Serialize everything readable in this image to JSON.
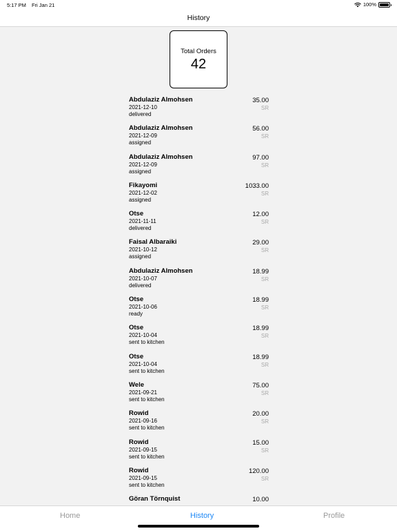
{
  "status_bar": {
    "time": "5:17 PM",
    "date": "Fri Jan 21",
    "battery": "100%",
    "battery_level": 1.0
  },
  "nav": {
    "title": "History"
  },
  "summary": {
    "label": "Total Orders",
    "value": "42"
  },
  "orders": [
    {
      "name": "Abdulaziz Almohsen",
      "date": "2021-12-10",
      "status": "delivered",
      "amount": "35.00",
      "currency": "SR"
    },
    {
      "name": "Abdulaziz Almohsen",
      "date": "2021-12-09",
      "status": "assigned",
      "amount": "56.00",
      "currency": "SR"
    },
    {
      "name": "Abdulaziz Almohsen",
      "date": "2021-12-09",
      "status": "assigned",
      "amount": "97.00",
      "currency": "SR"
    },
    {
      "name": "Fikayomi",
      "date": "2021-12-02",
      "status": "assigned",
      "amount": "1033.00",
      "currency": "SR"
    },
    {
      "name": "Otse",
      "date": "2021-11-11",
      "status": "delivered",
      "amount": "12.00",
      "currency": "SR"
    },
    {
      "name": "Faisal Albaraiki",
      "date": "2021-10-12",
      "status": "assigned",
      "amount": "29.00",
      "currency": "SR"
    },
    {
      "name": "Abdulaziz Almohsen",
      "date": "2021-10-07",
      "status": "delivered",
      "amount": "18.99",
      "currency": "SR"
    },
    {
      "name": "Otse",
      "date": "2021-10-06",
      "status": "ready",
      "amount": "18.99",
      "currency": "SR"
    },
    {
      "name": "Otse",
      "date": "2021-10-04",
      "status": "sent to kitchen",
      "amount": "18.99",
      "currency": "SR"
    },
    {
      "name": "Otse",
      "date": "2021-10-04",
      "status": "sent to kitchen",
      "amount": "18.99",
      "currency": "SR"
    },
    {
      "name": "Wele",
      "date": "2021-09-21",
      "status": "sent to kitchen",
      "amount": "75.00",
      "currency": "SR"
    },
    {
      "name": "Rowid",
      "date": "2021-09-16",
      "status": "sent to kitchen",
      "amount": "20.00",
      "currency": "SR"
    },
    {
      "name": "Rowid",
      "date": "2021-09-15",
      "status": "sent to kitchen",
      "amount": "15.00",
      "currency": "SR"
    },
    {
      "name": "Rowid",
      "date": "2021-09-15",
      "status": "sent to kitchen",
      "amount": "120.00",
      "currency": "SR"
    },
    {
      "name": "Göran Törnquist",
      "date": "",
      "status": "",
      "amount": "10.00",
      "currency": ""
    }
  ],
  "tabs": [
    {
      "label": "Home",
      "active": false
    },
    {
      "label": "History",
      "active": true
    },
    {
      "label": "Profile",
      "active": false
    }
  ],
  "colors": {
    "accent": "#1e88f5",
    "inactive_tab": "#999999",
    "currency": "#a9a9a9",
    "background": "#f2f2f2"
  },
  "icons": [
    "wifi-icon",
    "battery-icon"
  ]
}
